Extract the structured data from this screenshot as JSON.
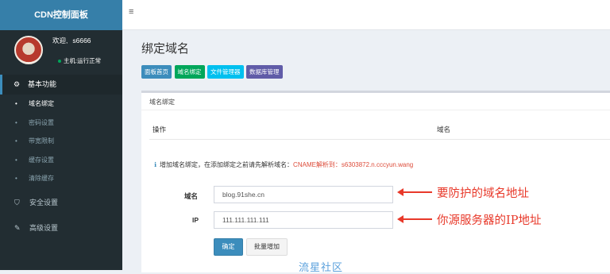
{
  "sidebar": {
    "brand": "CDN控制面板",
    "welcome": "欢迎,",
    "username": "s6666",
    "status": "主机:运行正常",
    "section_basic": "基本功能",
    "sub_items": [
      "域名绑定",
      "密码设置",
      "带宽限制",
      "缓存设置",
      "清除缓存"
    ],
    "menu_security": "安全设置",
    "menu_advanced": "高级设置"
  },
  "topbar": {
    "toggle_icon": "hamburger-icon"
  },
  "page": {
    "title": "绑定域名",
    "crumbs": [
      {
        "label": "面板首页",
        "color": "#3c8dbc"
      },
      {
        "label": "域名绑定",
        "color": "#00a65a"
      },
      {
        "label": "文件管理器",
        "color": "#00c0ef"
      },
      {
        "label": "数据库管理",
        "color": "#605ca8"
      }
    ]
  },
  "box": {
    "title": "域名绑定",
    "col_action": "操作",
    "col_domain": "域名",
    "notice_text": "增加域名绑定，在添加绑定之前请先解析域名：",
    "notice_cname": "CNAME解析到：s6303872.n.cccyun.wang"
  },
  "form": {
    "domain_label": "域名",
    "domain_value": "blog.91she.cn",
    "ip_label": "IP",
    "ip_value": "111.111.111.111",
    "confirm_button": "确定",
    "bulk_add_button": "批量增加"
  },
  "annotations": {
    "domain_note": "要防护的域名地址",
    "ip_note": "你源服务器的IP地址",
    "watermark": "流星社区"
  },
  "colors": {
    "accent": "#3c8dbc",
    "sidebar_bg": "#222d32",
    "annotation": "#e8392a"
  }
}
